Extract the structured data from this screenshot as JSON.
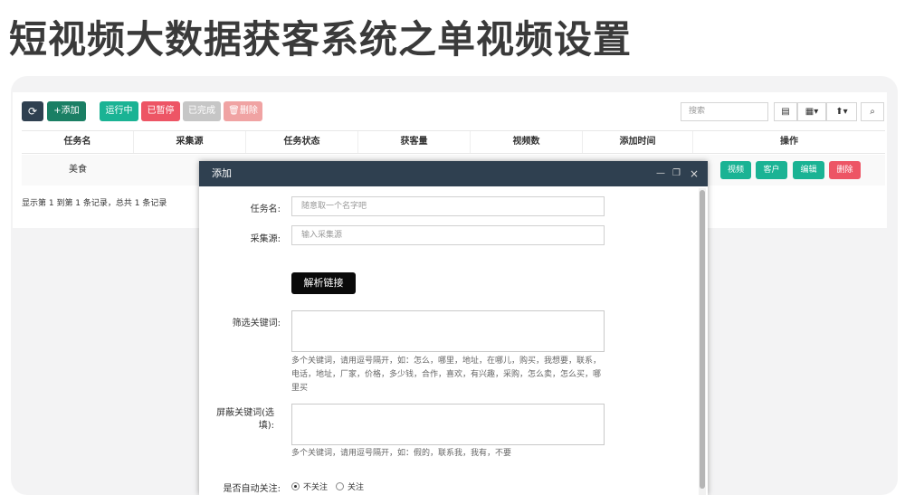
{
  "headline": "短视频大数据获客系统之单视频设置",
  "toolbar": {
    "refresh_icon": "⟳",
    "add": "+添加",
    "running": "运行中",
    "paused": "已暂停",
    "done": "已完成",
    "delete": "🗑删除",
    "search_placeholder": "搜索",
    "view_icon": "▤",
    "columns_icon": "▦▾",
    "export_icon": "⬆▾",
    "search_icon": "⌕"
  },
  "table": {
    "headers": [
      "任务名",
      "采集源",
      "任务状态",
      "获客量",
      "视频数",
      "添加时间",
      "操作"
    ],
    "rows": [
      {
        "name": "美食",
        "actions": [
          "视频",
          "客户",
          "编辑",
          "删除"
        ]
      }
    ],
    "footer": "显示第 1 到第 1 条记录，总共 1 条记录"
  },
  "modal": {
    "title": "添加",
    "controls": {
      "minimize": "—",
      "restore": "❐",
      "close": "×"
    },
    "fields": {
      "task_name_label": "任务名:",
      "task_name_placeholder": "随意取一个名字吧",
      "source_label": "采集源:",
      "source_placeholder": "输入采集源",
      "parse_button": "解析链接",
      "filter_label": "筛选关键词:",
      "filter_hint": "多个关键词，请用逗号隔开，如：怎么，哪里，地址，在哪儿，购买，我想要，联系，电话，地址，厂家，价格，多少钱，合作，喜欢，有兴趣，采购，怎么卖，怎么买，哪里买",
      "block_label": "屏蔽关键词(选填):",
      "block_hint": "多个关键词，请用逗号隔开，如：假的，联系我，我有，不要",
      "follow_label": "是否自动关注:",
      "follow_options": [
        "不关注",
        "关注"
      ],
      "follow_selected": "不关注"
    }
  }
}
